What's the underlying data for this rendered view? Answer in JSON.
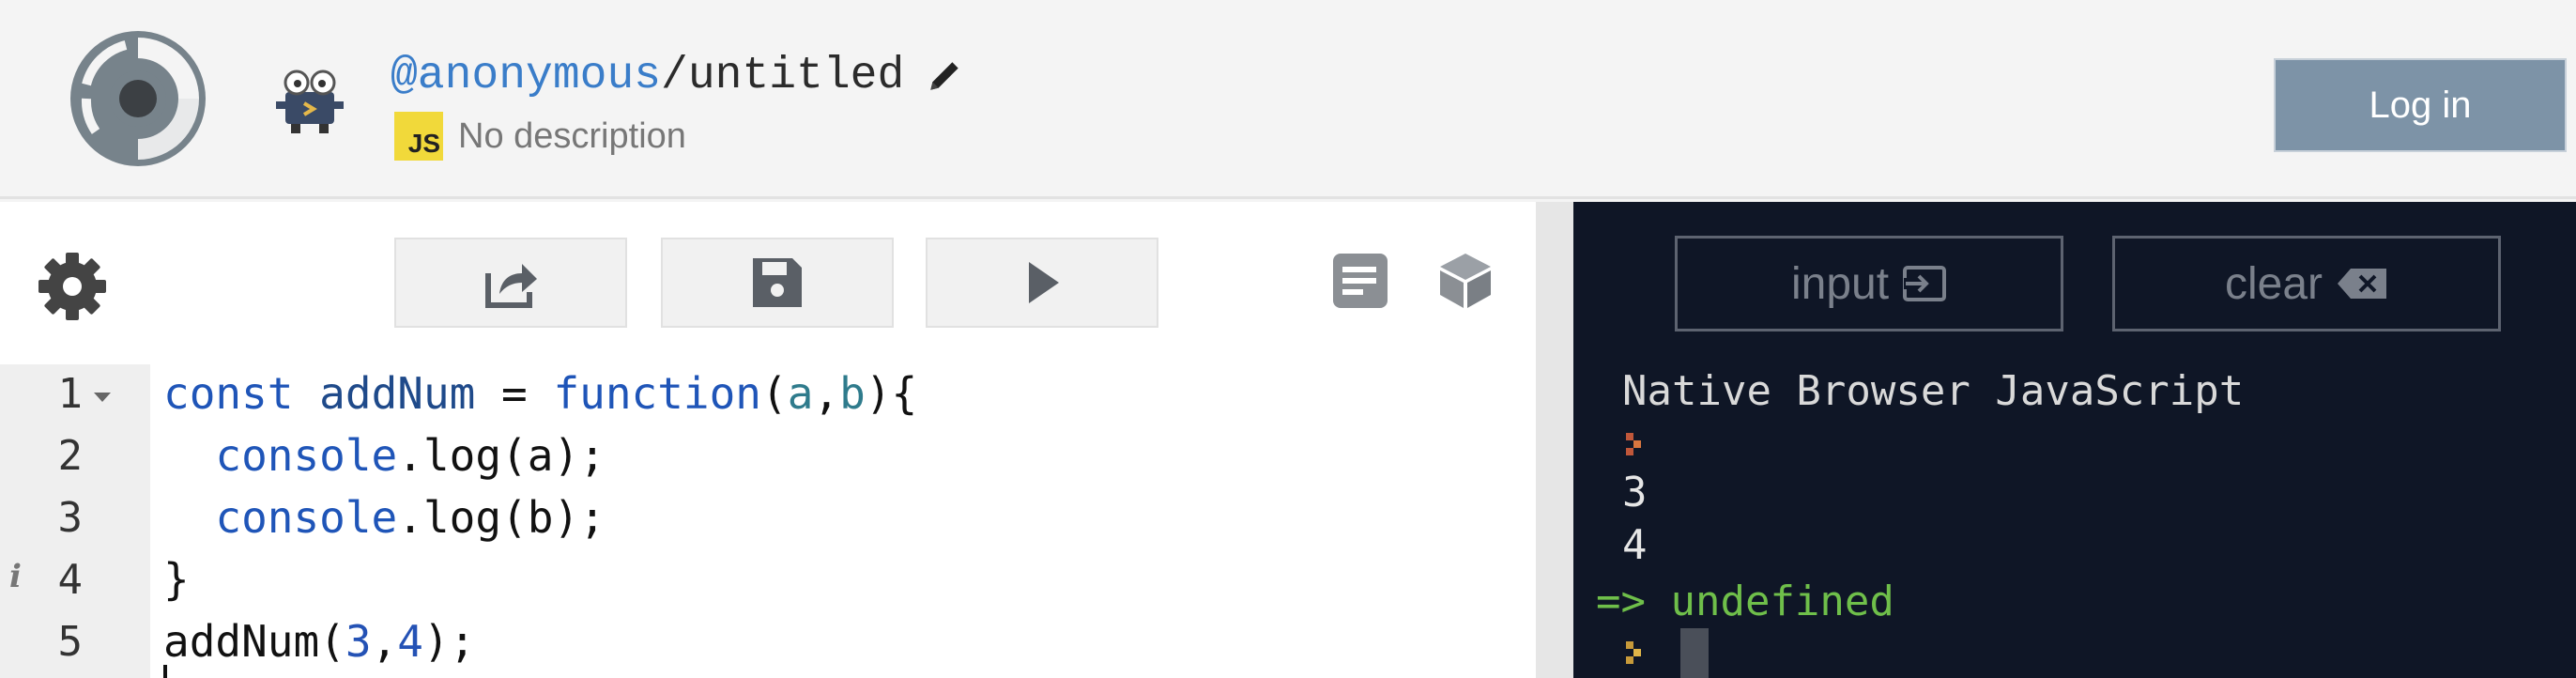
{
  "header": {
    "owner": "@anonymous",
    "repl_name": "/untitled",
    "language_badge": "JS",
    "description": "No description",
    "login_label": "Log in"
  },
  "editor": {
    "lines": [
      {
        "number": "1"
      },
      {
        "number": "2"
      },
      {
        "number": "3"
      },
      {
        "number": "4"
      },
      {
        "number": "5"
      }
    ],
    "code": {
      "l1": {
        "kw1": "const",
        "name": " addNum ",
        "op": "= ",
        "kw2": "function",
        "p1": "(",
        "a": "a",
        "comma": ",",
        "b": "b",
        "p2": "){"
      },
      "l2": {
        "indent": "  ",
        "obj": "console",
        "dot": ".",
        "call": "log(a);"
      },
      "l3": {
        "indent": "  ",
        "obj": "console",
        "dot": ".",
        "call": "log(b);"
      },
      "l4": {
        "text": "}"
      },
      "l5": {
        "call": "addNum(",
        "n1": "3",
        "comma": ",",
        "n2": "4",
        "end": ");"
      }
    }
  },
  "console": {
    "input_label": "input",
    "clear_label": "clear",
    "language_line": "Native Browser JavaScript",
    "outputs": [
      "3",
      "4"
    ],
    "result_arrow": "=>",
    "result_value": "undefined"
  },
  "colors": {
    "accent_blue": "#3a7dc9",
    "login_bg": "#7d93a7",
    "console_bg": "#0f1626",
    "result_green": "#6fbf4a",
    "js_yellow": "#f1d93a"
  },
  "icons": [
    "logo-icon",
    "avatar-icon",
    "pencil-icon",
    "gear-icon",
    "share-icon",
    "save-icon",
    "play-icon",
    "file-text-icon",
    "package-icon",
    "input-icon",
    "backspace-icon",
    "prompt-icon"
  ]
}
